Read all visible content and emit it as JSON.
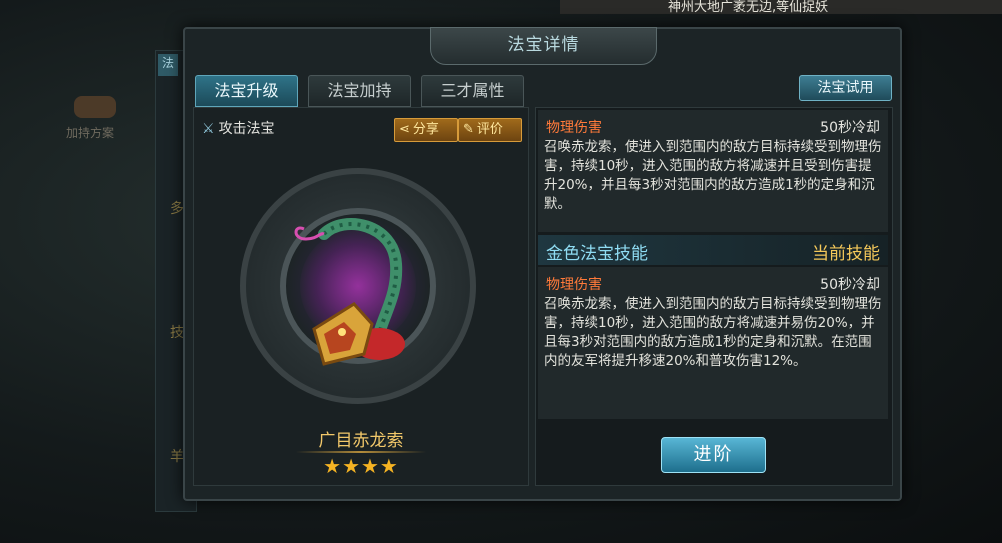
{
  "background": {
    "top_notice": "神州大地广袤无边,等仙捉妖",
    "side_label": "加持方案",
    "side_tab": "法",
    "side_chars": [
      "法",
      "多",
      "技",
      "羊"
    ]
  },
  "dialog": {
    "title": "法宝详情",
    "tabs": [
      {
        "label": "法宝升级",
        "active": true
      },
      {
        "label": "法宝加持",
        "active": false
      },
      {
        "label": "三才属性",
        "active": false
      }
    ],
    "trial_button": "法宝试用"
  },
  "treasure": {
    "type_label": "攻击法宝",
    "share_label": "分享",
    "rate_label": "评价",
    "name": "广目赤龙索",
    "stars_display": "★★★★",
    "star_count": 4,
    "icon": "red-dragon-rope-icon"
  },
  "skills": [
    {
      "type": "物理伤害",
      "cooldown": "50秒冷却",
      "description": "召唤赤龙索，使进入到范围内的敌方目标持续受到物理伤害，持续10秒，进入范围的敌方将减速并且受到伤害提升20%，并且每3秒对范围内的敌方造成1秒的定身和沉默。"
    },
    {
      "type": "物理伤害",
      "cooldown": "50秒冷却",
      "description": "召唤赤龙索，使进入到范围内的敌方目标持续受到物理伤害，持续10秒，进入范围的敌方将减速并易伤20%，并且每3秒对范围内的敌方造成1秒的定身和沉默。在范围内的友军将提升移速20%和普攻伤害12%。"
    }
  ],
  "golden_skill": {
    "title": "金色法宝技能",
    "current": "当前技能"
  },
  "advance_button": "进阶",
  "colors": {
    "accent_cyan": "#2f7388",
    "gold": "#f2c86a",
    "damage_orange": "#ff7a3a",
    "button_gold": "#a06a1b"
  }
}
